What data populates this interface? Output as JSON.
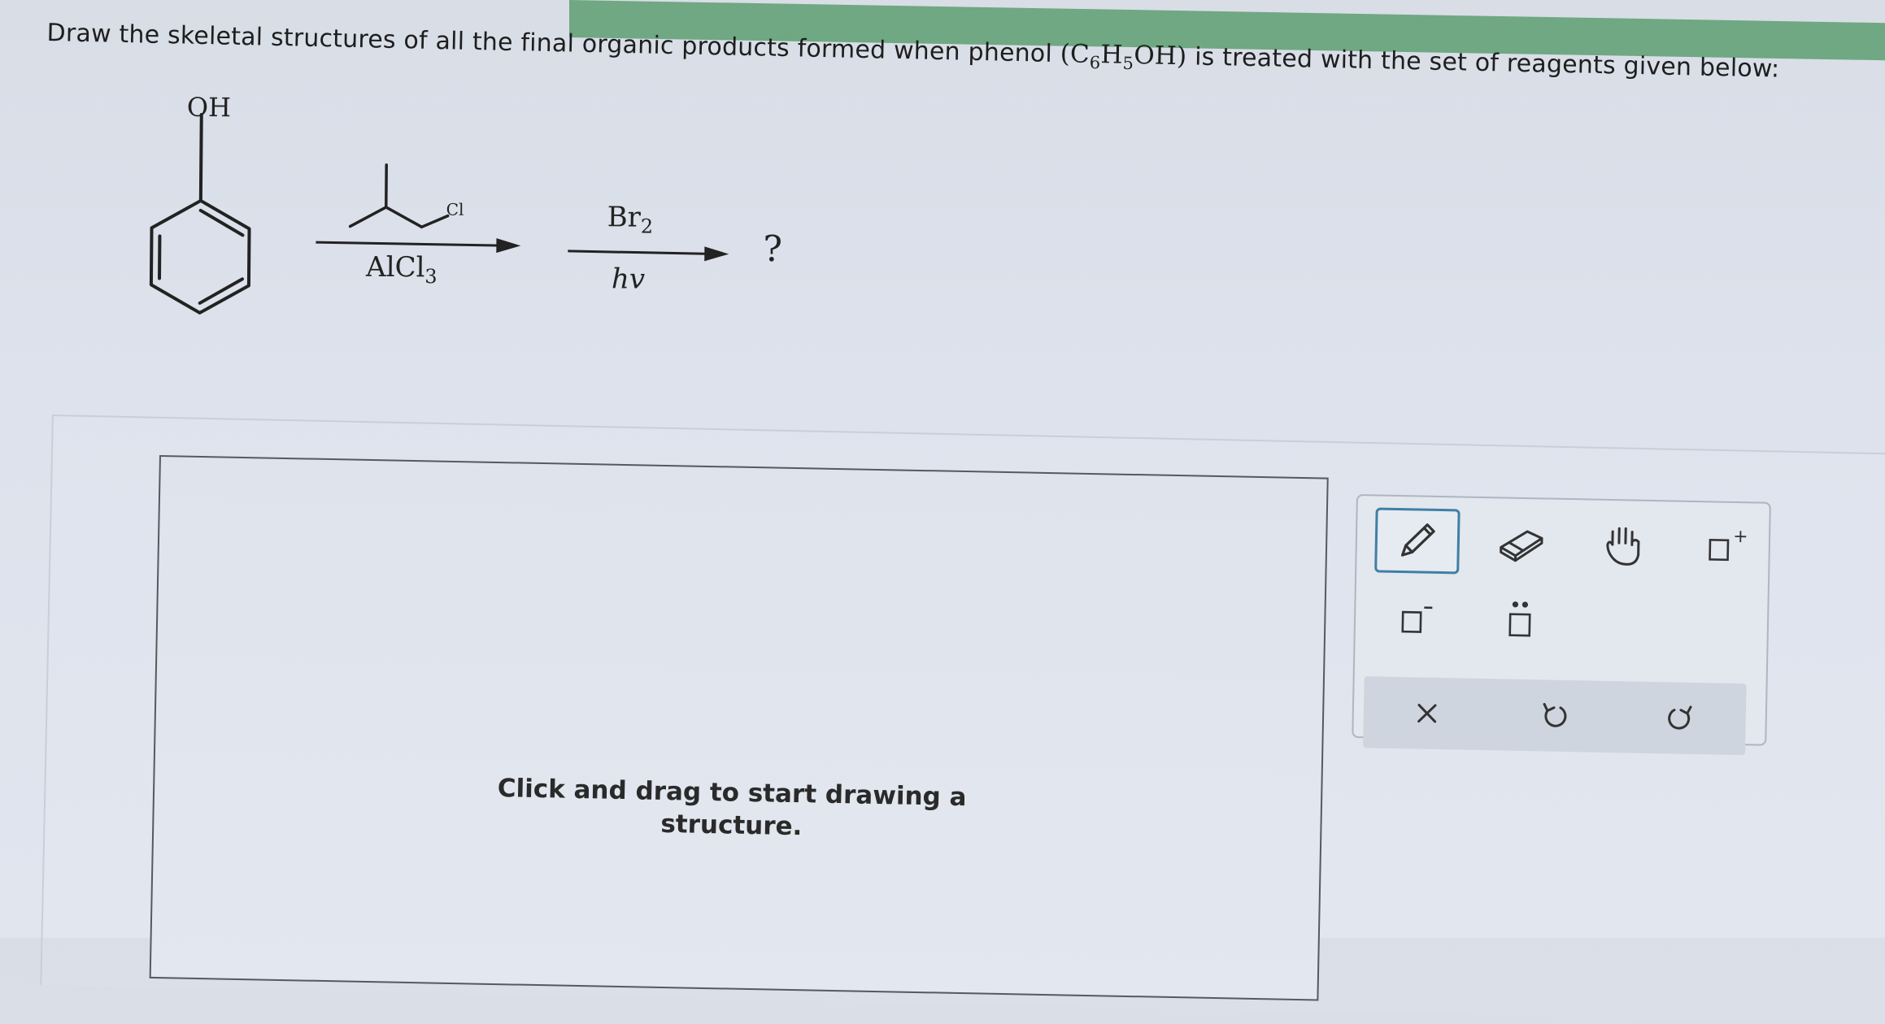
{
  "question": {
    "text": "Draw the skeletal structures of all the final organic products formed when phenol",
    "formula_c": "C",
    "formula_c_sub": "6",
    "formula_h": "H",
    "formula_h_sub": "5",
    "formula_oh": "OH",
    "text_after": "is treated with the set of reagents given below:"
  },
  "scheme": {
    "phenol_oh_label": "OH",
    "step1_chloride_label": "Cl",
    "step1_catalyst": "AlCl",
    "step1_catalyst_sub": "3",
    "step2_reagent": "Br",
    "step2_reagent_sub": "2",
    "step2_condition": "hv",
    "product_placeholder": "?"
  },
  "canvas": {
    "hint_line1": "Click and drag to start drawing a",
    "hint_line2": "structure."
  },
  "toolbar": {
    "tools": [
      "pencil-icon",
      "eraser-icon",
      "hand-icon",
      "positive-charge-icon",
      "negative-charge-icon",
      "lone-pair-icon"
    ],
    "actions": [
      "close-icon",
      "undo-icon",
      "redo-icon"
    ]
  },
  "colors": {
    "top_strip": "#6fa882",
    "selected_tool_border": "#3f7fa6",
    "background": "#dde2ec"
  }
}
